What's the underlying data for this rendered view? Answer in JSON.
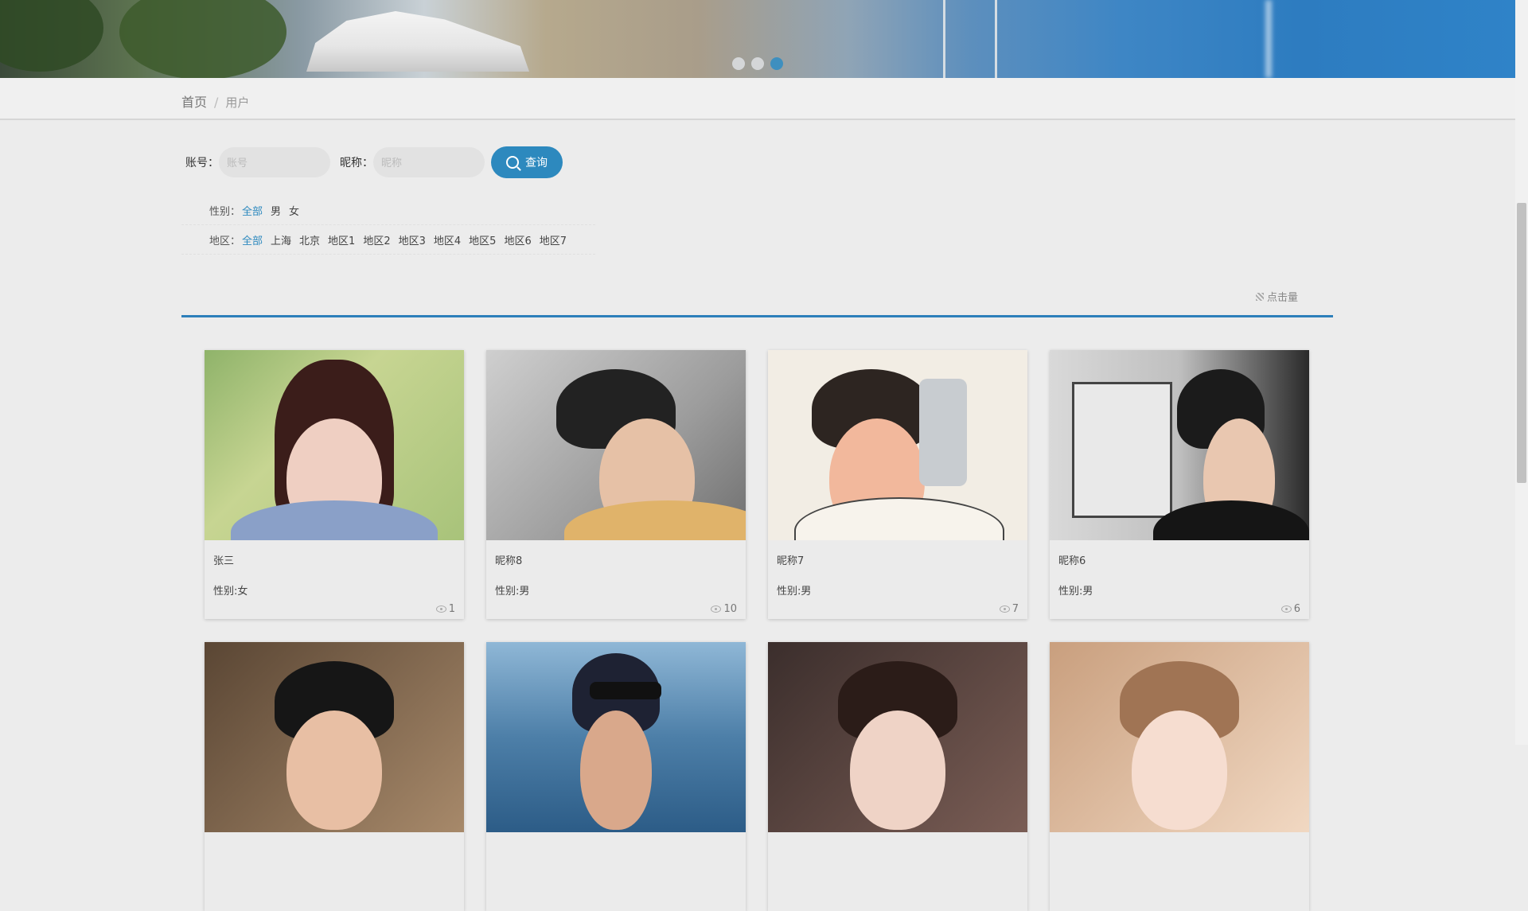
{
  "banner": {
    "slides": 3,
    "active_slide": 3
  },
  "breadcrumb": {
    "home": "首页",
    "separator": "/",
    "current": "用户"
  },
  "search": {
    "account_label": "账号：",
    "account_placeholder": "账号",
    "account_value": "",
    "nickname_label": "昵称：",
    "nickname_placeholder": "昵称",
    "nickname_value": "",
    "query_button": "查询",
    "query_icon": "search-icon"
  },
  "filters": {
    "gender": {
      "title": "性别：",
      "options": [
        "全部",
        "男",
        "女"
      ],
      "selected": "全部"
    },
    "region": {
      "title": "地区：",
      "options": [
        "全部",
        "上海",
        "北京",
        "地区1",
        "地区2",
        "地区3",
        "地区4",
        "地区5",
        "地区6",
        "地区7"
      ],
      "selected": "全部"
    }
  },
  "sort": {
    "label": "点击量",
    "icon": "sort-icon",
    "accent_color": "#2d7fba"
  },
  "users": [
    {
      "nickname": "张三",
      "gender": "性别:女",
      "views": "1"
    },
    {
      "nickname": "昵称8",
      "gender": "性别:男",
      "views": "10"
    },
    {
      "nickname": "昵称7",
      "gender": "性别:男",
      "views": "7"
    },
    {
      "nickname": "昵称6",
      "gender": "性别:男",
      "views": "6"
    },
    {
      "nickname": "",
      "gender": "",
      "views": ""
    },
    {
      "nickname": "",
      "gender": "",
      "views": ""
    },
    {
      "nickname": "",
      "gender": "",
      "views": ""
    },
    {
      "nickname": "",
      "gender": "",
      "views": ""
    }
  ],
  "colors": {
    "accent": "#2d89be",
    "background": "#ececec"
  }
}
